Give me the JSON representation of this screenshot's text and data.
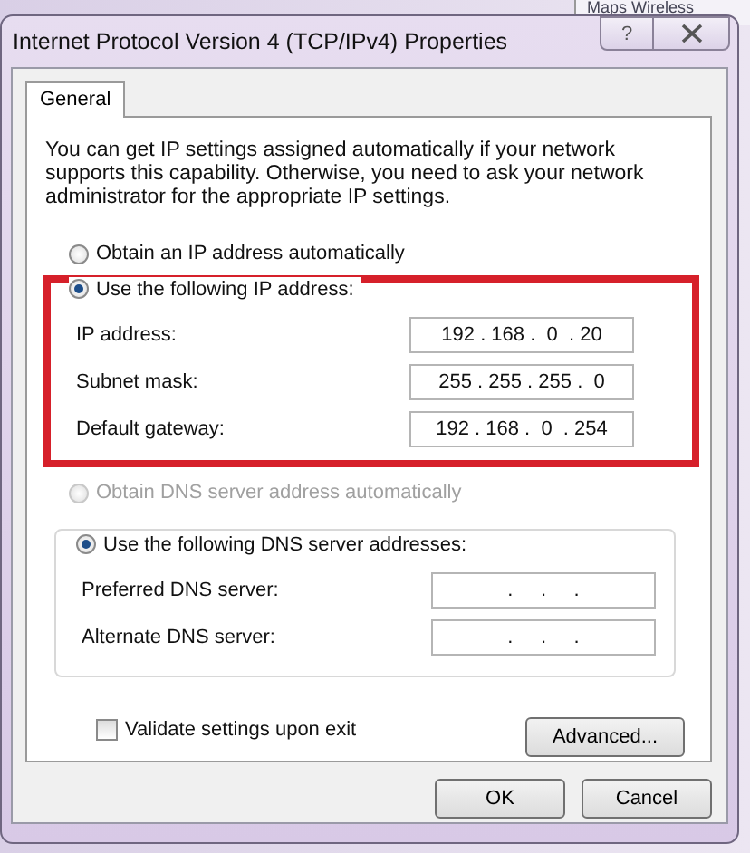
{
  "background_window": {
    "title": "Maps Wireless"
  },
  "window": {
    "title": "Internet Protocol Version 4 (TCP/IPv4) Properties",
    "help": "?"
  },
  "tabs": [
    {
      "label": "General",
      "selected": true
    }
  ],
  "intro": "You can get IP settings assigned automatically if your network supports this capability. Otherwise, you need to ask your network administrator for the appropriate IP settings.",
  "ip_mode": [
    {
      "label": "Obtain an IP address automatically",
      "selected": false,
      "disabled": false
    },
    {
      "label": "Use the following IP address:",
      "selected": true,
      "disabled": false
    }
  ],
  "ip_group": {
    "highlighted": true,
    "fields": [
      {
        "label": "IP address:",
        "value": "192 . 168 .  0  . 20"
      },
      {
        "label": "Subnet mask:",
        "value": "255 . 255 . 255 .  0"
      },
      {
        "label": "Default gateway:",
        "value": "192 . 168 .  0  . 254"
      }
    ]
  },
  "dns_mode": [
    {
      "label": "Obtain DNS server address automatically",
      "selected": false,
      "disabled": true
    },
    {
      "label": "Use the following DNS server addresses:",
      "selected": true,
      "disabled": false
    }
  ],
  "dns_fields": [
    {
      "label": "Preferred DNS server:",
      "value": ".     .     ."
    },
    {
      "label": "Alternate DNS server:",
      "value": ".     .     ."
    }
  ],
  "validate": {
    "label": "Validate settings upon exit",
    "checked": false
  },
  "advanced_button": "Advanced...",
  "buttons": [
    "OK",
    "Cancel"
  ]
}
